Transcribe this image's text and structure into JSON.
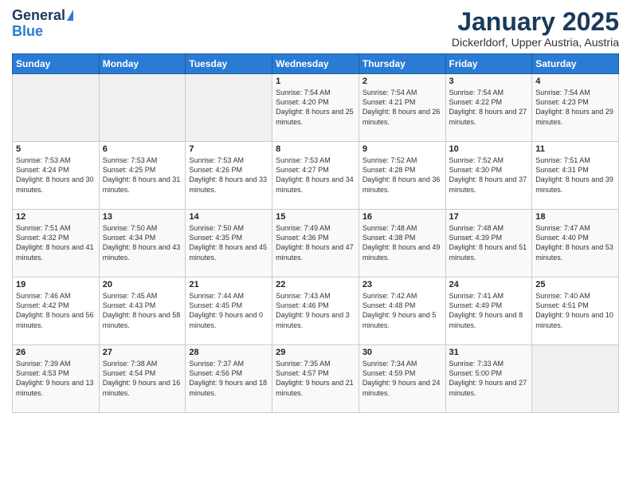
{
  "logo": {
    "general": "General",
    "blue": "Blue"
  },
  "title": "January 2025",
  "subtitle": "Dickerldorf, Upper Austria, Austria",
  "weekdays": [
    "Sunday",
    "Monday",
    "Tuesday",
    "Wednesday",
    "Thursday",
    "Friday",
    "Saturday"
  ],
  "weeks": [
    [
      {
        "day": "",
        "sunrise": "",
        "sunset": "",
        "daylight": ""
      },
      {
        "day": "",
        "sunrise": "",
        "sunset": "",
        "daylight": ""
      },
      {
        "day": "",
        "sunrise": "",
        "sunset": "",
        "daylight": ""
      },
      {
        "day": "1",
        "sunrise": "Sunrise: 7:54 AM",
        "sunset": "Sunset: 4:20 PM",
        "daylight": "Daylight: 8 hours and 25 minutes."
      },
      {
        "day": "2",
        "sunrise": "Sunrise: 7:54 AM",
        "sunset": "Sunset: 4:21 PM",
        "daylight": "Daylight: 8 hours and 26 minutes."
      },
      {
        "day": "3",
        "sunrise": "Sunrise: 7:54 AM",
        "sunset": "Sunset: 4:22 PM",
        "daylight": "Daylight: 8 hours and 27 minutes."
      },
      {
        "day": "4",
        "sunrise": "Sunrise: 7:54 AM",
        "sunset": "Sunset: 4:23 PM",
        "daylight": "Daylight: 8 hours and 29 minutes."
      }
    ],
    [
      {
        "day": "5",
        "sunrise": "Sunrise: 7:53 AM",
        "sunset": "Sunset: 4:24 PM",
        "daylight": "Daylight: 8 hours and 30 minutes."
      },
      {
        "day": "6",
        "sunrise": "Sunrise: 7:53 AM",
        "sunset": "Sunset: 4:25 PM",
        "daylight": "Daylight: 8 hours and 31 minutes."
      },
      {
        "day": "7",
        "sunrise": "Sunrise: 7:53 AM",
        "sunset": "Sunset: 4:26 PM",
        "daylight": "Daylight: 8 hours and 33 minutes."
      },
      {
        "day": "8",
        "sunrise": "Sunrise: 7:53 AM",
        "sunset": "Sunset: 4:27 PM",
        "daylight": "Daylight: 8 hours and 34 minutes."
      },
      {
        "day": "9",
        "sunrise": "Sunrise: 7:52 AM",
        "sunset": "Sunset: 4:28 PM",
        "daylight": "Daylight: 8 hours and 36 minutes."
      },
      {
        "day": "10",
        "sunrise": "Sunrise: 7:52 AM",
        "sunset": "Sunset: 4:30 PM",
        "daylight": "Daylight: 8 hours and 37 minutes."
      },
      {
        "day": "11",
        "sunrise": "Sunrise: 7:51 AM",
        "sunset": "Sunset: 4:31 PM",
        "daylight": "Daylight: 8 hours and 39 minutes."
      }
    ],
    [
      {
        "day": "12",
        "sunrise": "Sunrise: 7:51 AM",
        "sunset": "Sunset: 4:32 PM",
        "daylight": "Daylight: 8 hours and 41 minutes."
      },
      {
        "day": "13",
        "sunrise": "Sunrise: 7:50 AM",
        "sunset": "Sunset: 4:34 PM",
        "daylight": "Daylight: 8 hours and 43 minutes."
      },
      {
        "day": "14",
        "sunrise": "Sunrise: 7:50 AM",
        "sunset": "Sunset: 4:35 PM",
        "daylight": "Daylight: 8 hours and 45 minutes."
      },
      {
        "day": "15",
        "sunrise": "Sunrise: 7:49 AM",
        "sunset": "Sunset: 4:36 PM",
        "daylight": "Daylight: 8 hours and 47 minutes."
      },
      {
        "day": "16",
        "sunrise": "Sunrise: 7:48 AM",
        "sunset": "Sunset: 4:38 PM",
        "daylight": "Daylight: 8 hours and 49 minutes."
      },
      {
        "day": "17",
        "sunrise": "Sunrise: 7:48 AM",
        "sunset": "Sunset: 4:39 PM",
        "daylight": "Daylight: 8 hours and 51 minutes."
      },
      {
        "day": "18",
        "sunrise": "Sunrise: 7:47 AM",
        "sunset": "Sunset: 4:40 PM",
        "daylight": "Daylight: 8 hours and 53 minutes."
      }
    ],
    [
      {
        "day": "19",
        "sunrise": "Sunrise: 7:46 AM",
        "sunset": "Sunset: 4:42 PM",
        "daylight": "Daylight: 8 hours and 56 minutes."
      },
      {
        "day": "20",
        "sunrise": "Sunrise: 7:45 AM",
        "sunset": "Sunset: 4:43 PM",
        "daylight": "Daylight: 8 hours and 58 minutes."
      },
      {
        "day": "21",
        "sunrise": "Sunrise: 7:44 AM",
        "sunset": "Sunset: 4:45 PM",
        "daylight": "Daylight: 9 hours and 0 minutes."
      },
      {
        "day": "22",
        "sunrise": "Sunrise: 7:43 AM",
        "sunset": "Sunset: 4:46 PM",
        "daylight": "Daylight: 9 hours and 3 minutes."
      },
      {
        "day": "23",
        "sunrise": "Sunrise: 7:42 AM",
        "sunset": "Sunset: 4:48 PM",
        "daylight": "Daylight: 9 hours and 5 minutes."
      },
      {
        "day": "24",
        "sunrise": "Sunrise: 7:41 AM",
        "sunset": "Sunset: 4:49 PM",
        "daylight": "Daylight: 9 hours and 8 minutes."
      },
      {
        "day": "25",
        "sunrise": "Sunrise: 7:40 AM",
        "sunset": "Sunset: 4:51 PM",
        "daylight": "Daylight: 9 hours and 10 minutes."
      }
    ],
    [
      {
        "day": "26",
        "sunrise": "Sunrise: 7:39 AM",
        "sunset": "Sunset: 4:53 PM",
        "daylight": "Daylight: 9 hours and 13 minutes."
      },
      {
        "day": "27",
        "sunrise": "Sunrise: 7:38 AM",
        "sunset": "Sunset: 4:54 PM",
        "daylight": "Daylight: 9 hours and 16 minutes."
      },
      {
        "day": "28",
        "sunrise": "Sunrise: 7:37 AM",
        "sunset": "Sunset: 4:56 PM",
        "daylight": "Daylight: 9 hours and 18 minutes."
      },
      {
        "day": "29",
        "sunrise": "Sunrise: 7:35 AM",
        "sunset": "Sunset: 4:57 PM",
        "daylight": "Daylight: 9 hours and 21 minutes."
      },
      {
        "day": "30",
        "sunrise": "Sunrise: 7:34 AM",
        "sunset": "Sunset: 4:59 PM",
        "daylight": "Daylight: 9 hours and 24 minutes."
      },
      {
        "day": "31",
        "sunrise": "Sunrise: 7:33 AM",
        "sunset": "Sunset: 5:00 PM",
        "daylight": "Daylight: 9 hours and 27 minutes."
      },
      {
        "day": "",
        "sunrise": "",
        "sunset": "",
        "daylight": ""
      }
    ]
  ]
}
